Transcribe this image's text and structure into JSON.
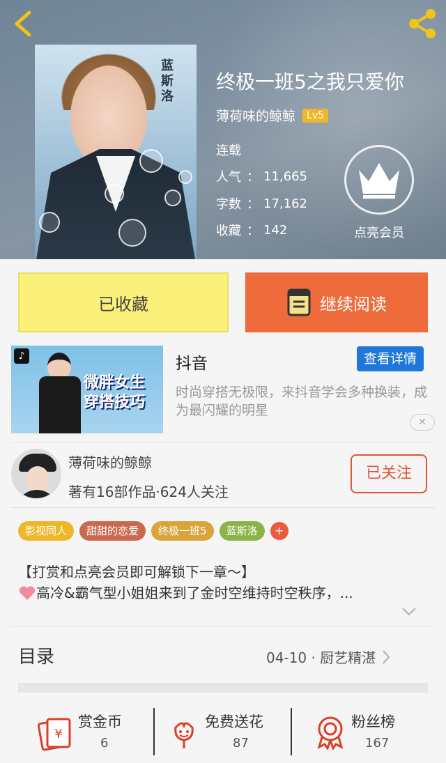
{
  "book": {
    "title": "终极一班5之我只爱你",
    "author": "薄荷味的鲸鲸",
    "level": "Lv5",
    "status": "连载",
    "cover_text": "蓝斯洛"
  },
  "stats": [
    {
      "label": "人气",
      "value": "11,665"
    },
    {
      "label": "字数",
      "value": "17,162"
    },
    {
      "label": "收藏",
      "value": "142"
    }
  ],
  "stat_separator": "：",
  "vip": {
    "label": "点亮会员",
    "icon": "crown-icon"
  },
  "actions": {
    "collect": "已收藏",
    "read": "继续阅读"
  },
  "ad": {
    "title": "抖音",
    "detail_button": "查看详情",
    "description": "时尚穿搭无极限，来抖音学会多种换装，成为最闪耀的明星",
    "image_text": "微胖女生穿搭技巧",
    "close": "✕"
  },
  "author_card": {
    "name": "薄荷味的鲸鲸",
    "meta": "著有16部作品·624人关注",
    "follow": "已关注"
  },
  "tags": [
    {
      "label": "影视同人",
      "color": "#f0b62a"
    },
    {
      "label": "甜甜的恋爱",
      "color": "#c96a4e"
    },
    {
      "label": "终极一班5",
      "color": "#d8a53d"
    },
    {
      "label": "蓝斯洛",
      "color": "#8bb34a"
    }
  ],
  "tag_add": "+",
  "intro": {
    "line1": "【打赏和点亮会员即可解锁下一章～】",
    "line2": "高冷&霸气型小姐姐来到了金时空维持时空秩序，..."
  },
  "toc": {
    "title": "目录",
    "latest": "04-10 · 厨艺精湛"
  },
  "bottom": [
    {
      "label": "赏金币",
      "value": "6",
      "icon": "red-envelope-icon"
    },
    {
      "label": "免费送花",
      "value": "87",
      "icon": "flower-icon"
    },
    {
      "label": "粉丝榜",
      "value": "167",
      "icon": "award-badge-icon"
    }
  ],
  "colors": {
    "accent": "#ee6b3b",
    "collect_bg": "#fbf17a",
    "vip_gold": "#f0b62a",
    "link_blue": "#1f77d9"
  }
}
